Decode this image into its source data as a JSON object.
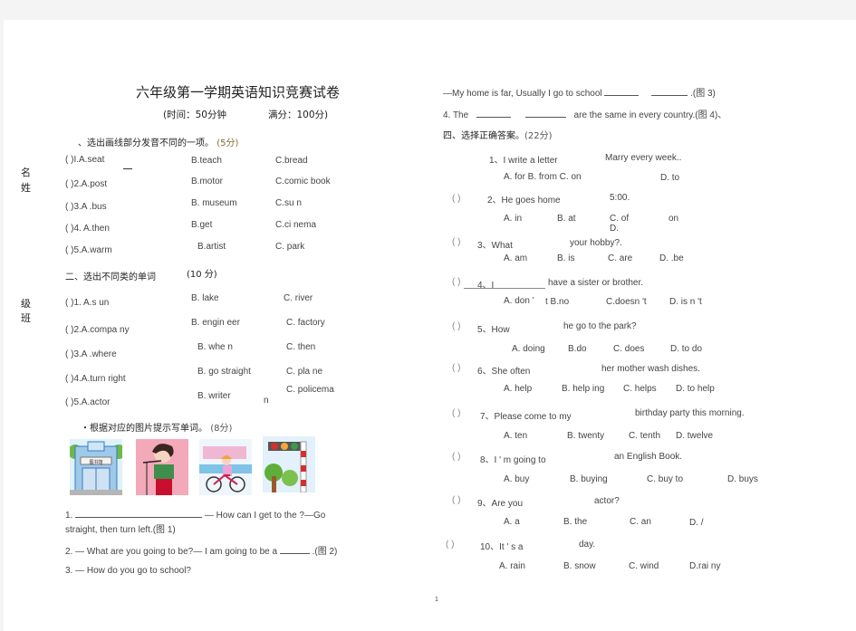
{
  "document": {
    "title": "六年级第一学期英语知识竞赛试卷",
    "subtitle_time": "(时间：50分钟",
    "subtitle_score": "满分：100分)",
    "page_number": "1"
  },
  "side_labels": {
    "name": [
      "名",
      "姓"
    ],
    "class": [
      "级",
      "班"
    ]
  },
  "section1": {
    "header": "、选出画线部分发音不同的一项。",
    "points": "(5分)",
    "rows": [
      {
        "q": "(        )I.A.seat",
        "b": "B.teach",
        "c": "C.bread"
      },
      {
        "q": "(        )2.A.post",
        "b": "B.motor",
        "c": "C.comic  book"
      },
      {
        "q": "(        )3.A  .bus",
        "b": "B.  museum",
        "c": "C.su  n"
      },
      {
        "q": "(        )4.  A.then",
        "b": "B.get",
        "c": "C.ci  nema"
      },
      {
        "q": "(        )5.A.warm",
        "b": "B.artist",
        "c": "C.  park"
      }
    ]
  },
  "section2": {
    "header": "二、选出不同类的单词",
    "points": "(10 分)",
    "rows": [
      {
        "q": "(        )1.  A.s  un",
        "b": "B.  lake",
        "c": "C.  river"
      },
      {
        "q": "(        )2.A.compa  ny",
        "b": "B.  engin  eer",
        "c": "C.  factory"
      },
      {
        "q": "(        )3.A  .where",
        "b": "B.  whe  n",
        "c": "C.  then"
      },
      {
        "q": "(        )4.A.turn  right",
        "b": "B.  go  straight",
        "c": "C.  pla  ne"
      },
      {
        "q": "(        )5.A.actor",
        "b": "B.  writer",
        "c": "C.  policema",
        "extra": "n"
      }
    ]
  },
  "section3": {
    "header": "・根据对应的图片提示写单词。",
    "points": "(8分)",
    "pictures": [
      {
        "label": "library-building",
        "sign_text": "图书馆"
      },
      {
        "label": "singer-woman"
      },
      {
        "label": "girl-riding-bike"
      },
      {
        "label": "traffic-lights"
      }
    ],
    "items": [
      {
        "num": "1.",
        "text": "— How can I get to the  ?—Go",
        "cont": "straight,  then  turn  left.(图  1)"
      },
      {
        "num": "2.",
        "text": "— What  are  you  going  to  be?— I  am  going  to  be  a",
        "tail": " .(图  2)"
      },
      {
        "num": "3.",
        "text": "— How  do  you  go  to  school?"
      },
      {
        "text": "—My  home  is  far,  Usually  I  go  to  school",
        "tail": " .(图  3)"
      },
      {
        "num": "4.",
        "text": "The",
        "tail_mid": "are  the  same  in  every  country.(图  4)、"
      }
    ]
  },
  "section4": {
    "header": "四、选择正确答案。",
    "points": "(22分)",
    "questions": [
      {
        "paren": "",
        "q": "1、I  write  a  letter",
        "q2": "Marry  every  week..",
        "opts": [
          "A.  for  B.  from  C.  on",
          "D.  to"
        ]
      },
      {
        "paren": "(        )",
        "q": "2、He  goes  home",
        "q2": "5:00.",
        "opts": [
          "A.  in",
          "B.  at",
          "C.  of",
          "on",
          "D."
        ]
      },
      {
        "paren": "(        )",
        "q": "3、What",
        "q2": "your  hobby?.",
        "opts": [
          "A.  am",
          "B.  is",
          "C.  are",
          "D.  .be"
        ]
      },
      {
        "paren": "(        )",
        "q": "4、I",
        "q2": "have  a  sister  or  brother.",
        "opts": [
          "A.  don  '",
          "t  B.no",
          "C.doesn  't",
          "D.  is  n  't"
        ]
      },
      {
        "paren": "(        )",
        "q": "5、How",
        "q2": "he  go  to  the  park?",
        "opts": [
          "A.  doing",
          "B.do",
          "C.  does",
          "D.  to  do"
        ]
      },
      {
        "paren": "(        )",
        "q": "6、She  often",
        "q2": "her  mother  wash  dishes.",
        "opts": [
          "A.  help",
          "B.  help  ing",
          "C.  helps",
          "D.  to  help"
        ]
      },
      {
        "paren": "(        )",
        "q": "7、Please  come  to  my",
        "q2": "birthday  party  this  morning.",
        "opts": [
          "A.  ten",
          "B.  twenty",
          "C.  tenth",
          "D.  twelve"
        ]
      },
      {
        "paren": "(        )",
        "q": "8、I  '  m  going  to",
        "q2": "an  English  Book.",
        "opts": [
          "A.  buy",
          "B.  buying",
          "C.  buy  to",
          "D.  buys"
        ]
      },
      {
        "paren": "(        )",
        "q": "9、Are  you",
        "q2": "actor?",
        "opts": [
          "A.  a",
          "B.  the",
          "C.  an",
          "D.  /"
        ]
      },
      {
        "paren": "(          )",
        "q": "10、It  '  s  a",
        "q2": "day.",
        "opts": [
          "A.  rain",
          "B.  snow",
          "C.  wind",
          "D.rai  ny"
        ]
      }
    ]
  }
}
